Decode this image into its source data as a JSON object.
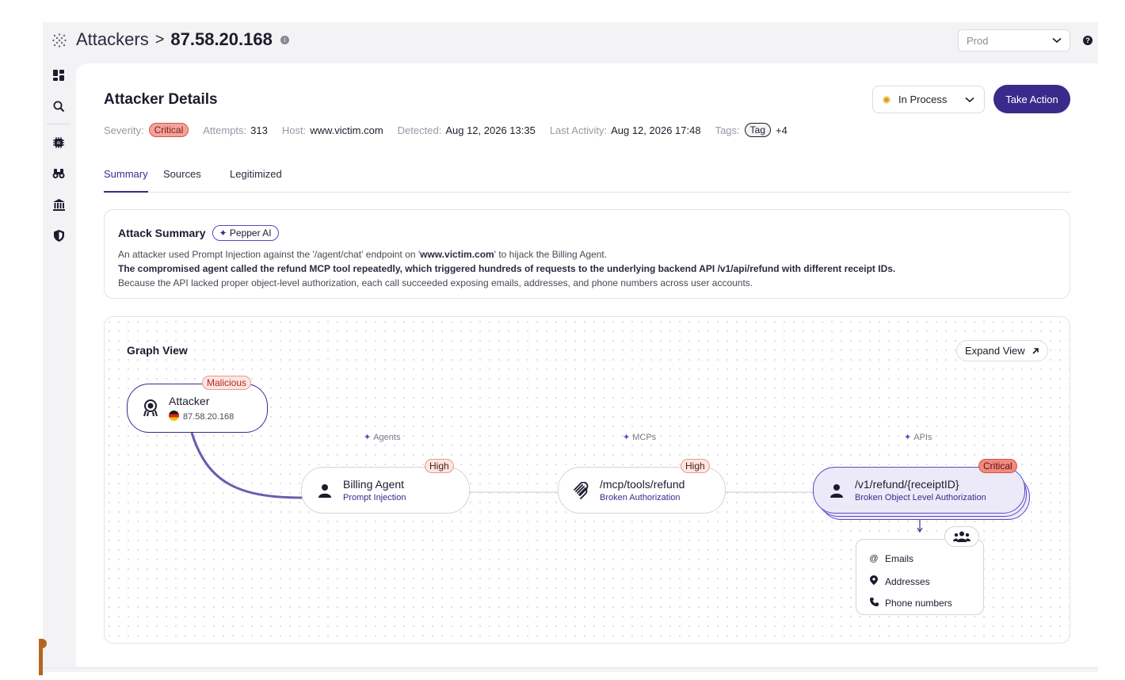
{
  "breadcrumb": {
    "root": "Attackers",
    "separator": ">",
    "current": "87.58.20.168"
  },
  "environment": {
    "selected": "Prod"
  },
  "sidebar": {
    "items": [
      {
        "name": "dashboard-icon"
      },
      {
        "name": "search-icon"
      },
      {
        "name": "ai-chip-icon"
      },
      {
        "name": "binoculars-icon"
      },
      {
        "name": "bank-icon"
      },
      {
        "name": "shield-icon"
      }
    ]
  },
  "details": {
    "title": "Attacker Details",
    "severity_label": "Severity:",
    "severity_value": "Critical",
    "attempts_label": "Attempts:",
    "attempts_value": "313",
    "host_label": "Host:",
    "host_value": "www.victim.com",
    "detected_label": "Detected:",
    "detected_value": "Aug 12, 2026 13:35",
    "last_activity_label": "Last Activity:",
    "last_activity_value": "Aug 12, 2026 17:48",
    "tags_label": "Tags:",
    "tag_value": "Tag",
    "tags_more": "+4"
  },
  "status": {
    "selected": "In Process",
    "color": "#d6a21a"
  },
  "take_action_label": "Take Action",
  "tabs": [
    {
      "label": "Summary",
      "active": true
    },
    {
      "label": "Sources",
      "active": false
    },
    {
      "label": "Legitimized",
      "active": false
    }
  ],
  "summary": {
    "title": "Attack Summary",
    "ai_label": "Pepper AI",
    "line1_a": "An attacker used Prompt Injection against the '/agent/chat'  endpoint on '",
    "line1_host": "www.victim.com",
    "line1_b": "' to hijack the Billing Agent.",
    "line2": "The compromised agent called the refund MCP tool repeatedly, which triggered hundreds of requests to the underlying backend API /v1/api/refund with different receipt IDs.",
    "line3": "Because the API lacked proper object-level authorization, each call succeeded exposing emails, addresses, and phone numbers across user accounts."
  },
  "graph": {
    "title": "Graph View",
    "expand_label": "Expand View",
    "columns": {
      "agents": "Agents",
      "mcps": "MCPs",
      "apis": "APIs"
    },
    "attacker": {
      "name": "Attacker",
      "ip": "87.58.20.168",
      "badge": "Malicious"
    },
    "agent": {
      "name": "Billing Agent",
      "sub": "Prompt Injection",
      "badge": "High"
    },
    "mcp": {
      "name": "/mcp/tools/refund",
      "sub": "Broken Authorization",
      "badge": "High"
    },
    "api": {
      "name": "/v1/refund/{receiptID}",
      "sub": "Broken Object Level Authorization",
      "badge": "Critical"
    },
    "exposed_data": [
      "Emails",
      "Addresses",
      "Phone numbers"
    ]
  },
  "colors": {
    "accent": "#3b2a8c",
    "critical": "#f08a7e",
    "high": "#fde5e2"
  }
}
